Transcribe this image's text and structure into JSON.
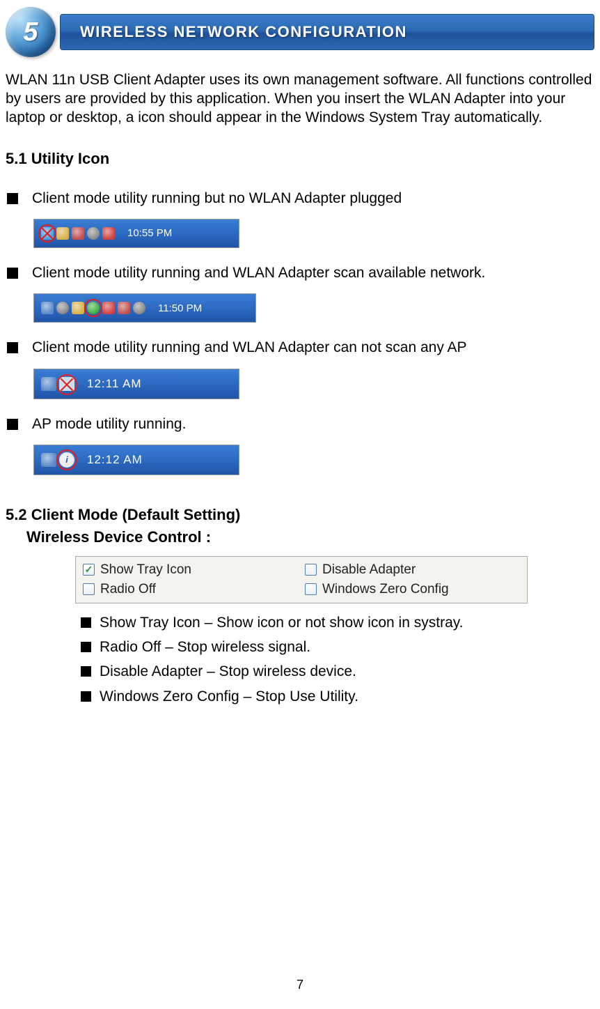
{
  "banner": {
    "number": "5",
    "title": "WIRELESS NETWORK CONFIGURATION"
  },
  "intro": "WLAN 11n USB Client Adapter uses its own management software. All functions controlled by users are provided by this application. When you insert the WLAN Adapter into your laptop or desktop, a icon should appear in the Windows System Tray automatically.",
  "section51_heading": "5.1 Utility Icon",
  "item1": {
    "text": "Client mode utility running but no WLAN Adapter plugged",
    "time": "10:55 PM"
  },
  "item2": {
    "text": "Client mode utility running and WLAN Adapter scan available network.",
    "time": "11:50 PM"
  },
  "item3": {
    "text": "Client mode utility running and WLAN Adapter can not scan any AP",
    "time": "12:11 AM"
  },
  "item4": {
    "text": "AP mode utility running.",
    "time": "12:12 AM"
  },
  "section52_heading": "5.2 Client Mode (Default Setting)",
  "section52_sub": "Wireless Device Control :",
  "options": {
    "show_tray": {
      "label": "Show Tray Icon",
      "checked": true
    },
    "radio_off": {
      "label": "Radio Off",
      "checked": false
    },
    "disable_adapter": {
      "label": "Disable Adapter",
      "checked": false
    },
    "zero_config": {
      "label": "Windows Zero Config",
      "checked": false
    }
  },
  "desc": {
    "show_tray": "Show Tray Icon – Show icon or not show icon in systray.",
    "radio_off": "Radio Off – Stop wireless signal.",
    "disable_adapter": "Disable Adapter – Stop wireless device.",
    "zero_config": " Windows Zero Config – Stop Use Utility."
  },
  "page_number": "7"
}
